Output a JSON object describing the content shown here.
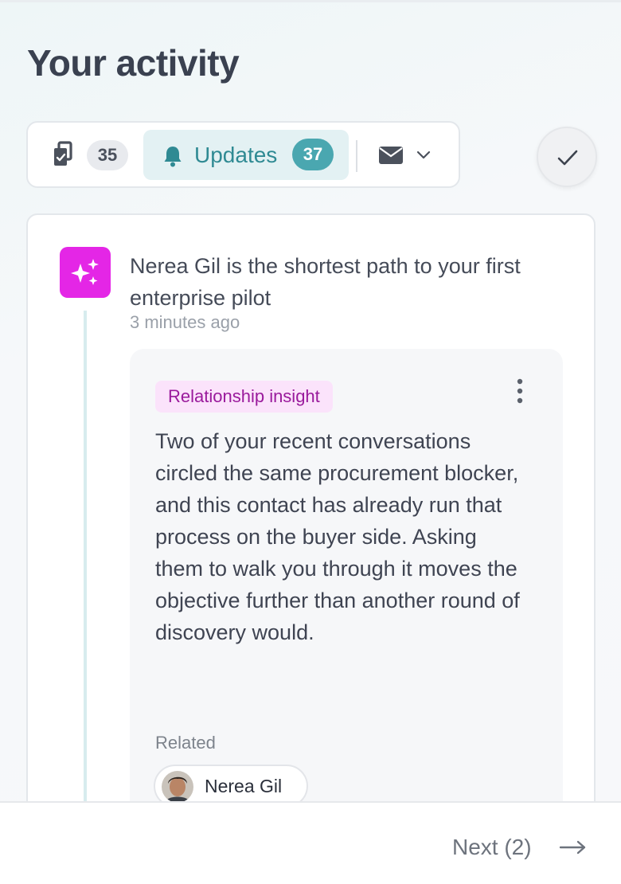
{
  "page": {
    "title": "Your activity"
  },
  "toolbar": {
    "tasks_count": "35",
    "updates_label": "Updates",
    "updates_count": "37"
  },
  "feed": {
    "item": {
      "title": "Nerea Gil is the shortest path to your first enterprise pilot",
      "time": "3 minutes ago",
      "tag": "Relationship insight",
      "body": "Two of your recent conversations circled the same procurement blocker, and this contact has already run that process on the buyer side. Asking them to walk you through it moves the objective further than another round of discovery would.",
      "related_label": "Related",
      "related_contact": "Nerea Gil"
    }
  },
  "footer": {
    "next_label": "Next (2)"
  },
  "colors": {
    "accent_teal": "#4aa7b0",
    "updates_tab_bg": "#e3f1f3",
    "sparkle_magenta": "#e426e6",
    "tag_bg": "#fbe3fb",
    "tag_text": "#9a1a9c"
  },
  "icons": [
    "copy-icon",
    "bell-icon",
    "mail-icon",
    "chevron-down-icon",
    "check-icon",
    "sparkles-icon",
    "more-vertical-icon",
    "arrow-right-icon"
  ]
}
